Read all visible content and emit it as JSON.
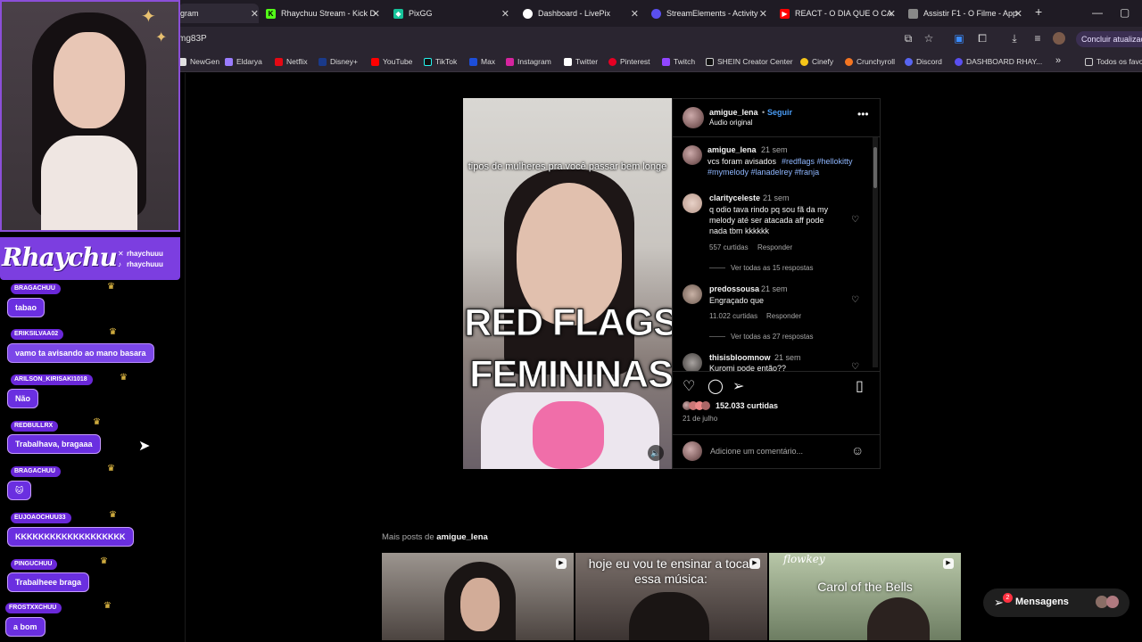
{
  "browser": {
    "tabs": [
      {
        "label": "gram",
        "active": true
      },
      {
        "label": "Rhaychuu Stream - Kick D"
      },
      {
        "label": "PixGG"
      },
      {
        "label": "Dashboard - LivePix"
      },
      {
        "label": "StreamElements - Activity"
      },
      {
        "label": "REACT - O DIA QUE O CA"
      },
      {
        "label": "Assistir F1 - O Filme - App"
      }
    ],
    "new_tab": "+",
    "url": "mg83P",
    "update_button": "Concluir atualização",
    "bookmarks": [
      "NewGen",
      "Eldarya",
      "Netflix",
      "Disney+",
      "YouTube",
      "TikTok",
      "Max",
      "Instagram",
      "Twitter",
      "Pinterest",
      "Twitch",
      "SHEIN Creator Center",
      "Cinefy",
      "Crunchyroll",
      "Discord",
      "DASHBOARD RHAY..."
    ],
    "bookmarks_more": "»",
    "all_favorites": "Todos os favo",
    "colors": {
      "tabbar": "#1f1b24",
      "toolbar": "#2a2530"
    }
  },
  "post": {
    "username": "amigue_lena",
    "follow": "Seguir",
    "separator": "•",
    "audio": "Áudio original",
    "overlay_top": "tipos de mulheres pra você passar bem longe",
    "overlay_line1": "RED FLAGS",
    "overlay_line2": "FEMININAS",
    "caption": {
      "user": "amigue_lena",
      "time": "21 sem",
      "text": "vcs foram avisados",
      "tags_line1": "#redflags #hellokitty",
      "tags_line2": "#mymelody #lanadelrey #franja"
    },
    "comments": [
      {
        "user": "clarityceleste",
        "time": "21 sem",
        "text_lines": [
          "q odio tava rindo pq sou fã da my",
          "melody até ser atacada aff pode",
          "nada tbm kkkkkk"
        ],
        "likes": "557 curtidas",
        "reply": "Responder",
        "view_replies": "Ver todas as 15 respostas"
      },
      {
        "user": "predossousa",
        "time": "21 sem",
        "text_lines": [
          "Engraçado que"
        ],
        "likes": "11.022 curtidas",
        "reply": "Responder",
        "view_replies": "Ver todas as 27 respostas"
      },
      {
        "user": "thisisbloomnow",
        "time": "21 sem",
        "text_lines": [
          "Kuromi pode então??"
        ]
      }
    ],
    "likes_count": "152.033 curtidas",
    "date": "21 de julho",
    "comment_placeholder": "Adicione um comentário...",
    "more_posts_prefix": "Mais posts de",
    "more_posts_user": "amigue_lena",
    "thumbnails": [
      {
        "text": ""
      },
      {
        "text": "hoje eu vou te ensinar a tocar essa música:"
      },
      {
        "text": "Carol of the Bells",
        "brand": "flowkey"
      }
    ],
    "messages_label": "Mensagens",
    "messages_badge": "2"
  },
  "stream": {
    "brand": "Rhaychu",
    "handles": [
      "rhaychuuu",
      "rhaychuuu"
    ],
    "chat": [
      {
        "user": "BRAGACHUU",
        "message": "tabao"
      },
      {
        "user": "ERIKSILVAA02",
        "message": "vamo ta avisando ao mano basara"
      },
      {
        "user": "ARILSON_KIRISAKI1018",
        "message": "Não"
      },
      {
        "user": "REDBULLRX",
        "message": "Trabalhava, bragaaa"
      },
      {
        "user": "BRAGACHUU",
        "message": "🐱"
      },
      {
        "user": "EUJOAOCHUU33",
        "message": "KKKKKKKKKKKKKKKKKKK"
      },
      {
        "user": "PINGUCHUU",
        "message": "Trabalheee braga"
      },
      {
        "user": "FROSTXXCHUU",
        "message": "a bom"
      }
    ],
    "accent": "#7c3ee0"
  }
}
